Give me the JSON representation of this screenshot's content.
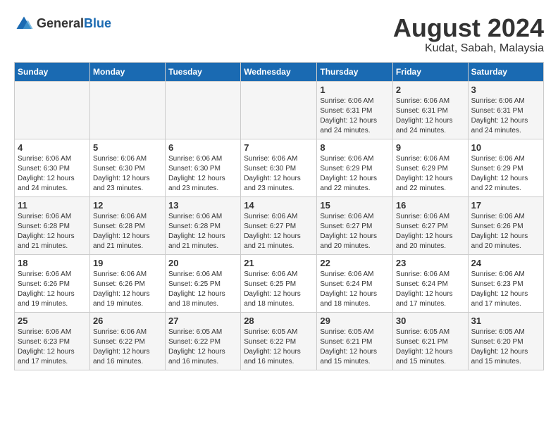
{
  "logo": {
    "general": "General",
    "blue": "Blue"
  },
  "title": "August 2024",
  "subtitle": "Kudat, Sabah, Malaysia",
  "days_of_week": [
    "Sunday",
    "Monday",
    "Tuesday",
    "Wednesday",
    "Thursday",
    "Friday",
    "Saturday"
  ],
  "weeks": [
    [
      {
        "day": "",
        "info": ""
      },
      {
        "day": "",
        "info": ""
      },
      {
        "day": "",
        "info": ""
      },
      {
        "day": "",
        "info": ""
      },
      {
        "day": "1",
        "info": "Sunrise: 6:06 AM\nSunset: 6:31 PM\nDaylight: 12 hours\nand 24 minutes."
      },
      {
        "day": "2",
        "info": "Sunrise: 6:06 AM\nSunset: 6:31 PM\nDaylight: 12 hours\nand 24 minutes."
      },
      {
        "day": "3",
        "info": "Sunrise: 6:06 AM\nSunset: 6:31 PM\nDaylight: 12 hours\nand 24 minutes."
      }
    ],
    [
      {
        "day": "4",
        "info": "Sunrise: 6:06 AM\nSunset: 6:30 PM\nDaylight: 12 hours\nand 24 minutes."
      },
      {
        "day": "5",
        "info": "Sunrise: 6:06 AM\nSunset: 6:30 PM\nDaylight: 12 hours\nand 23 minutes."
      },
      {
        "day": "6",
        "info": "Sunrise: 6:06 AM\nSunset: 6:30 PM\nDaylight: 12 hours\nand 23 minutes."
      },
      {
        "day": "7",
        "info": "Sunrise: 6:06 AM\nSunset: 6:30 PM\nDaylight: 12 hours\nand 23 minutes."
      },
      {
        "day": "8",
        "info": "Sunrise: 6:06 AM\nSunset: 6:29 PM\nDaylight: 12 hours\nand 22 minutes."
      },
      {
        "day": "9",
        "info": "Sunrise: 6:06 AM\nSunset: 6:29 PM\nDaylight: 12 hours\nand 22 minutes."
      },
      {
        "day": "10",
        "info": "Sunrise: 6:06 AM\nSunset: 6:29 PM\nDaylight: 12 hours\nand 22 minutes."
      }
    ],
    [
      {
        "day": "11",
        "info": "Sunrise: 6:06 AM\nSunset: 6:28 PM\nDaylight: 12 hours\nand 21 minutes."
      },
      {
        "day": "12",
        "info": "Sunrise: 6:06 AM\nSunset: 6:28 PM\nDaylight: 12 hours\nand 21 minutes."
      },
      {
        "day": "13",
        "info": "Sunrise: 6:06 AM\nSunset: 6:28 PM\nDaylight: 12 hours\nand 21 minutes."
      },
      {
        "day": "14",
        "info": "Sunrise: 6:06 AM\nSunset: 6:27 PM\nDaylight: 12 hours\nand 21 minutes."
      },
      {
        "day": "15",
        "info": "Sunrise: 6:06 AM\nSunset: 6:27 PM\nDaylight: 12 hours\nand 20 minutes."
      },
      {
        "day": "16",
        "info": "Sunrise: 6:06 AM\nSunset: 6:27 PM\nDaylight: 12 hours\nand 20 minutes."
      },
      {
        "day": "17",
        "info": "Sunrise: 6:06 AM\nSunset: 6:26 PM\nDaylight: 12 hours\nand 20 minutes."
      }
    ],
    [
      {
        "day": "18",
        "info": "Sunrise: 6:06 AM\nSunset: 6:26 PM\nDaylight: 12 hours\nand 19 minutes."
      },
      {
        "day": "19",
        "info": "Sunrise: 6:06 AM\nSunset: 6:26 PM\nDaylight: 12 hours\nand 19 minutes."
      },
      {
        "day": "20",
        "info": "Sunrise: 6:06 AM\nSunset: 6:25 PM\nDaylight: 12 hours\nand 18 minutes."
      },
      {
        "day": "21",
        "info": "Sunrise: 6:06 AM\nSunset: 6:25 PM\nDaylight: 12 hours\nand 18 minutes."
      },
      {
        "day": "22",
        "info": "Sunrise: 6:06 AM\nSunset: 6:24 PM\nDaylight: 12 hours\nand 18 minutes."
      },
      {
        "day": "23",
        "info": "Sunrise: 6:06 AM\nSunset: 6:24 PM\nDaylight: 12 hours\nand 17 minutes."
      },
      {
        "day": "24",
        "info": "Sunrise: 6:06 AM\nSunset: 6:23 PM\nDaylight: 12 hours\nand 17 minutes."
      }
    ],
    [
      {
        "day": "25",
        "info": "Sunrise: 6:06 AM\nSunset: 6:23 PM\nDaylight: 12 hours\nand 17 minutes."
      },
      {
        "day": "26",
        "info": "Sunrise: 6:06 AM\nSunset: 6:22 PM\nDaylight: 12 hours\nand 16 minutes."
      },
      {
        "day": "27",
        "info": "Sunrise: 6:05 AM\nSunset: 6:22 PM\nDaylight: 12 hours\nand 16 minutes."
      },
      {
        "day": "28",
        "info": "Sunrise: 6:05 AM\nSunset: 6:22 PM\nDaylight: 12 hours\nand 16 minutes."
      },
      {
        "day": "29",
        "info": "Sunrise: 6:05 AM\nSunset: 6:21 PM\nDaylight: 12 hours\nand 15 minutes."
      },
      {
        "day": "30",
        "info": "Sunrise: 6:05 AM\nSunset: 6:21 PM\nDaylight: 12 hours\nand 15 minutes."
      },
      {
        "day": "31",
        "info": "Sunrise: 6:05 AM\nSunset: 6:20 PM\nDaylight: 12 hours\nand 15 minutes."
      }
    ]
  ]
}
